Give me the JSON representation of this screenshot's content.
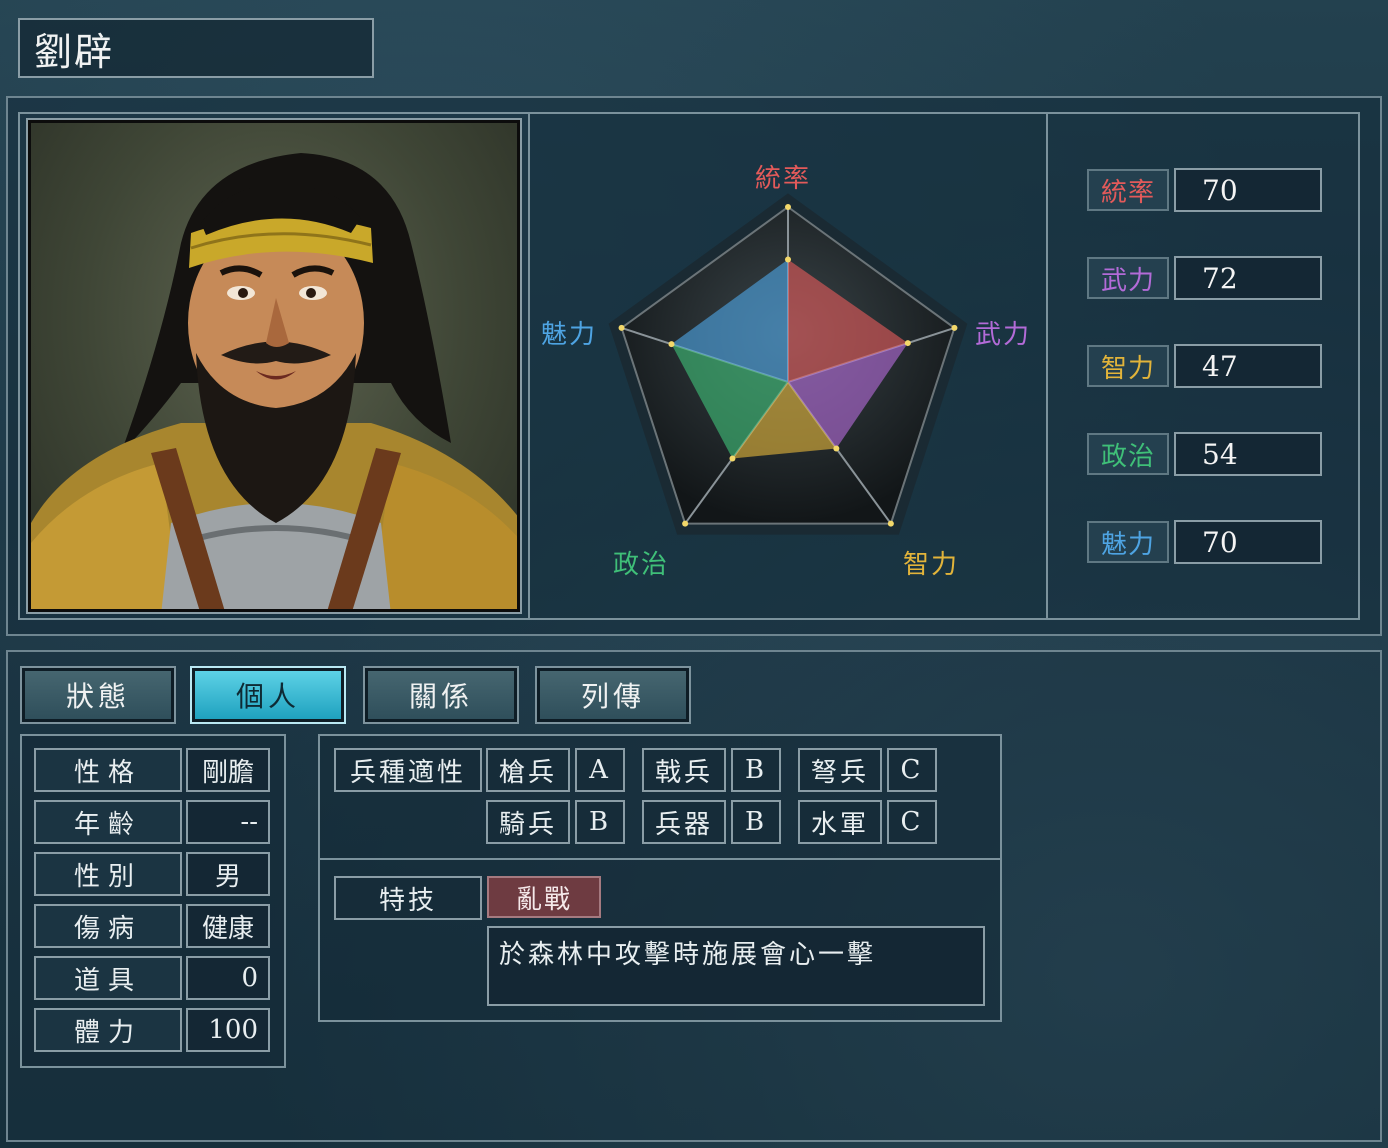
{
  "officer": {
    "name": "劉辟"
  },
  "radar": {
    "labels": [
      {
        "key": "統率",
        "color": "#e35a5a"
      },
      {
        "key": "武力",
        "color": "#b36bd8"
      },
      {
        "key": "智力",
        "color": "#e2b43a"
      },
      {
        "key": "政治",
        "color": "#3fbf78"
      },
      {
        "key": "魅力",
        "color": "#4ea4e3"
      }
    ],
    "max": 100
  },
  "stats": [
    {
      "label": "統率",
      "value": "70",
      "color": "#e35a5a"
    },
    {
      "label": "武力",
      "value": "72",
      "color": "#b36bd8"
    },
    {
      "label": "智力",
      "value": "47",
      "color": "#e2b43a"
    },
    {
      "label": "政治",
      "value": "54",
      "color": "#3fbf78"
    },
    {
      "label": "魅力",
      "value": "70",
      "color": "#4ea4e3"
    }
  ],
  "tabs": [
    "狀態",
    "個人",
    "關係",
    "列傳"
  ],
  "active_tab": "個人",
  "info": [
    {
      "label": "性格",
      "value": "剛膽"
    },
    {
      "label": "年齡",
      "value": "--"
    },
    {
      "label": "性別",
      "value": "男"
    },
    {
      "label": "傷病",
      "value": "健康"
    },
    {
      "label": "道具",
      "value": "0"
    },
    {
      "label": "體力",
      "value": "100"
    }
  ],
  "aptitude": {
    "title": "兵種適性",
    "units": [
      {
        "name": "槍兵",
        "grade": "A"
      },
      {
        "name": "戟兵",
        "grade": "B"
      },
      {
        "name": "弩兵",
        "grade": "C"
      },
      {
        "name": "騎兵",
        "grade": "B"
      },
      {
        "name": "兵器",
        "grade": "B"
      },
      {
        "name": "水軍",
        "grade": "C"
      }
    ]
  },
  "skill": {
    "label": "特技",
    "name": "亂戰",
    "description": "於森林中攻擊時施展會心一擊"
  }
}
